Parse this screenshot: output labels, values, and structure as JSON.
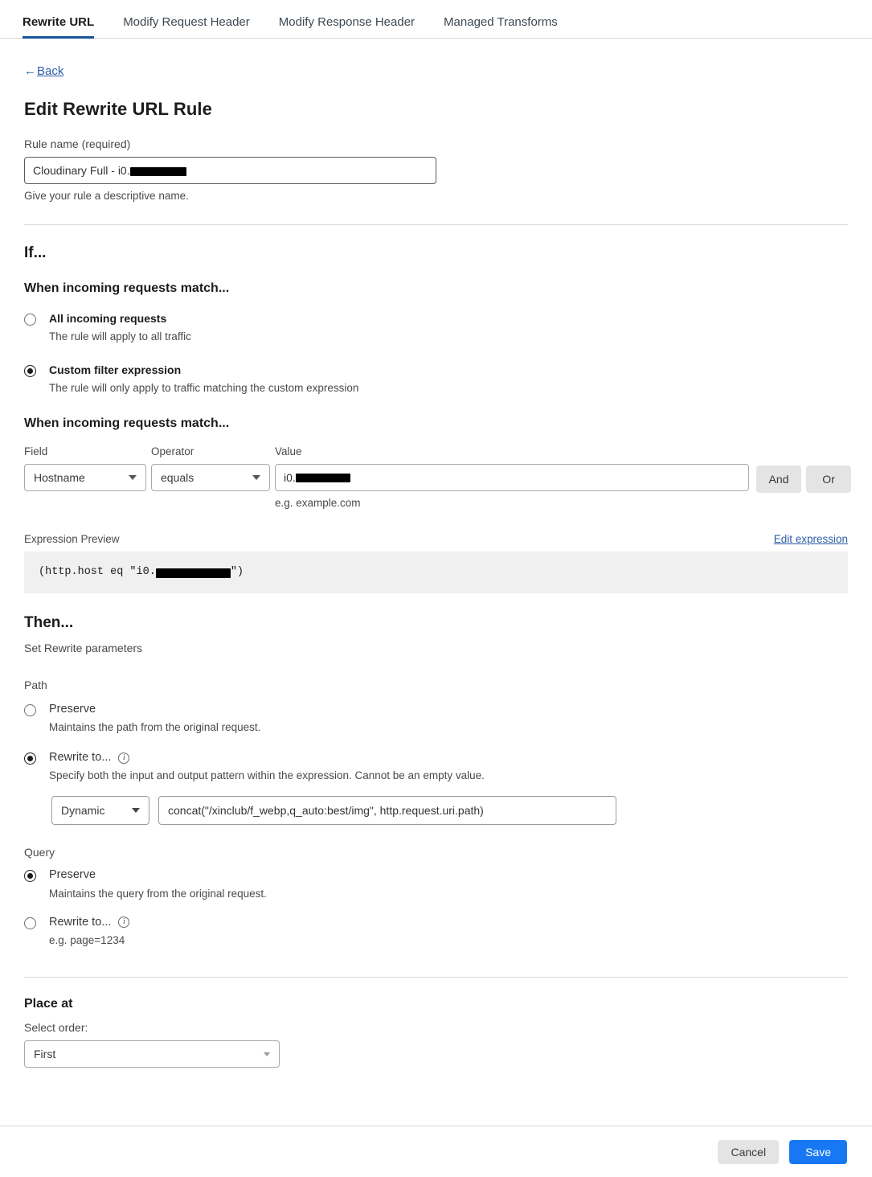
{
  "tabs": [
    {
      "label": "Rewrite URL",
      "active": true
    },
    {
      "label": "Modify Request Header",
      "active": false
    },
    {
      "label": "Modify Response Header",
      "active": false
    },
    {
      "label": "Managed Transforms",
      "active": false
    }
  ],
  "back": {
    "arrow": "←",
    "label": "Back"
  },
  "page_title": "Edit Rewrite URL Rule",
  "rule_name": {
    "label": "Rule name (required)",
    "value_prefix": "Cloudinary Full - i0.",
    "value_redacted": true,
    "hint": "Give your rule a descriptive name."
  },
  "if_section": {
    "heading": "If...",
    "subheading": "When incoming requests match...",
    "options": [
      {
        "title": "All incoming requests",
        "desc": "The rule will apply to all traffic",
        "selected": false
      },
      {
        "title": "Custom filter expression",
        "desc": "The rule will only apply to traffic matching the custom expression",
        "selected": true
      }
    ]
  },
  "filter": {
    "heading": "When incoming requests match...",
    "field_label": "Field",
    "field_value": "Hostname",
    "operator_label": "Operator",
    "operator_value": "equals",
    "value_label": "Value",
    "value_prefix": "i0.",
    "value_hint": "e.g. example.com",
    "and_label": "And",
    "or_label": "Or"
  },
  "expression": {
    "label": "Expression Preview",
    "edit_label": "Edit expression",
    "prefix": "(http.host eq \"i0.",
    "suffix": "\")"
  },
  "then_section": {
    "heading": "Then...",
    "subheading": "Set Rewrite parameters"
  },
  "path": {
    "label": "Path",
    "options": [
      {
        "title": "Preserve",
        "desc": "Maintains the path from the original request.",
        "selected": false,
        "info": false
      },
      {
        "title": "Rewrite to...",
        "desc": "Specify both the input and output pattern within the expression. Cannot be an empty value.",
        "selected": true,
        "info": true
      }
    ],
    "mode_value": "Dynamic",
    "expression_value": "concat(\"/xinclub/f_webp,q_auto:best/img\", http.request.uri.path)"
  },
  "query": {
    "label": "Query",
    "options": [
      {
        "title": "Preserve",
        "desc": "Maintains the query from the original request.",
        "selected": true,
        "info": false
      },
      {
        "title": "Rewrite to...",
        "desc": "e.g. page=1234",
        "selected": false,
        "info": true
      }
    ]
  },
  "place_at": {
    "heading": "Place at",
    "select_label": "Select order:",
    "order_value": "First"
  },
  "footer": {
    "cancel_label": "Cancel",
    "save_label": "Save"
  },
  "icons": {
    "info": "i",
    "chevron_down": "chevron-down-icon"
  },
  "colors": {
    "accent_tab": "#17549a",
    "link": "#2d5ca8",
    "save_button": "#1878f3",
    "muted_button": "#e4e4e4"
  }
}
